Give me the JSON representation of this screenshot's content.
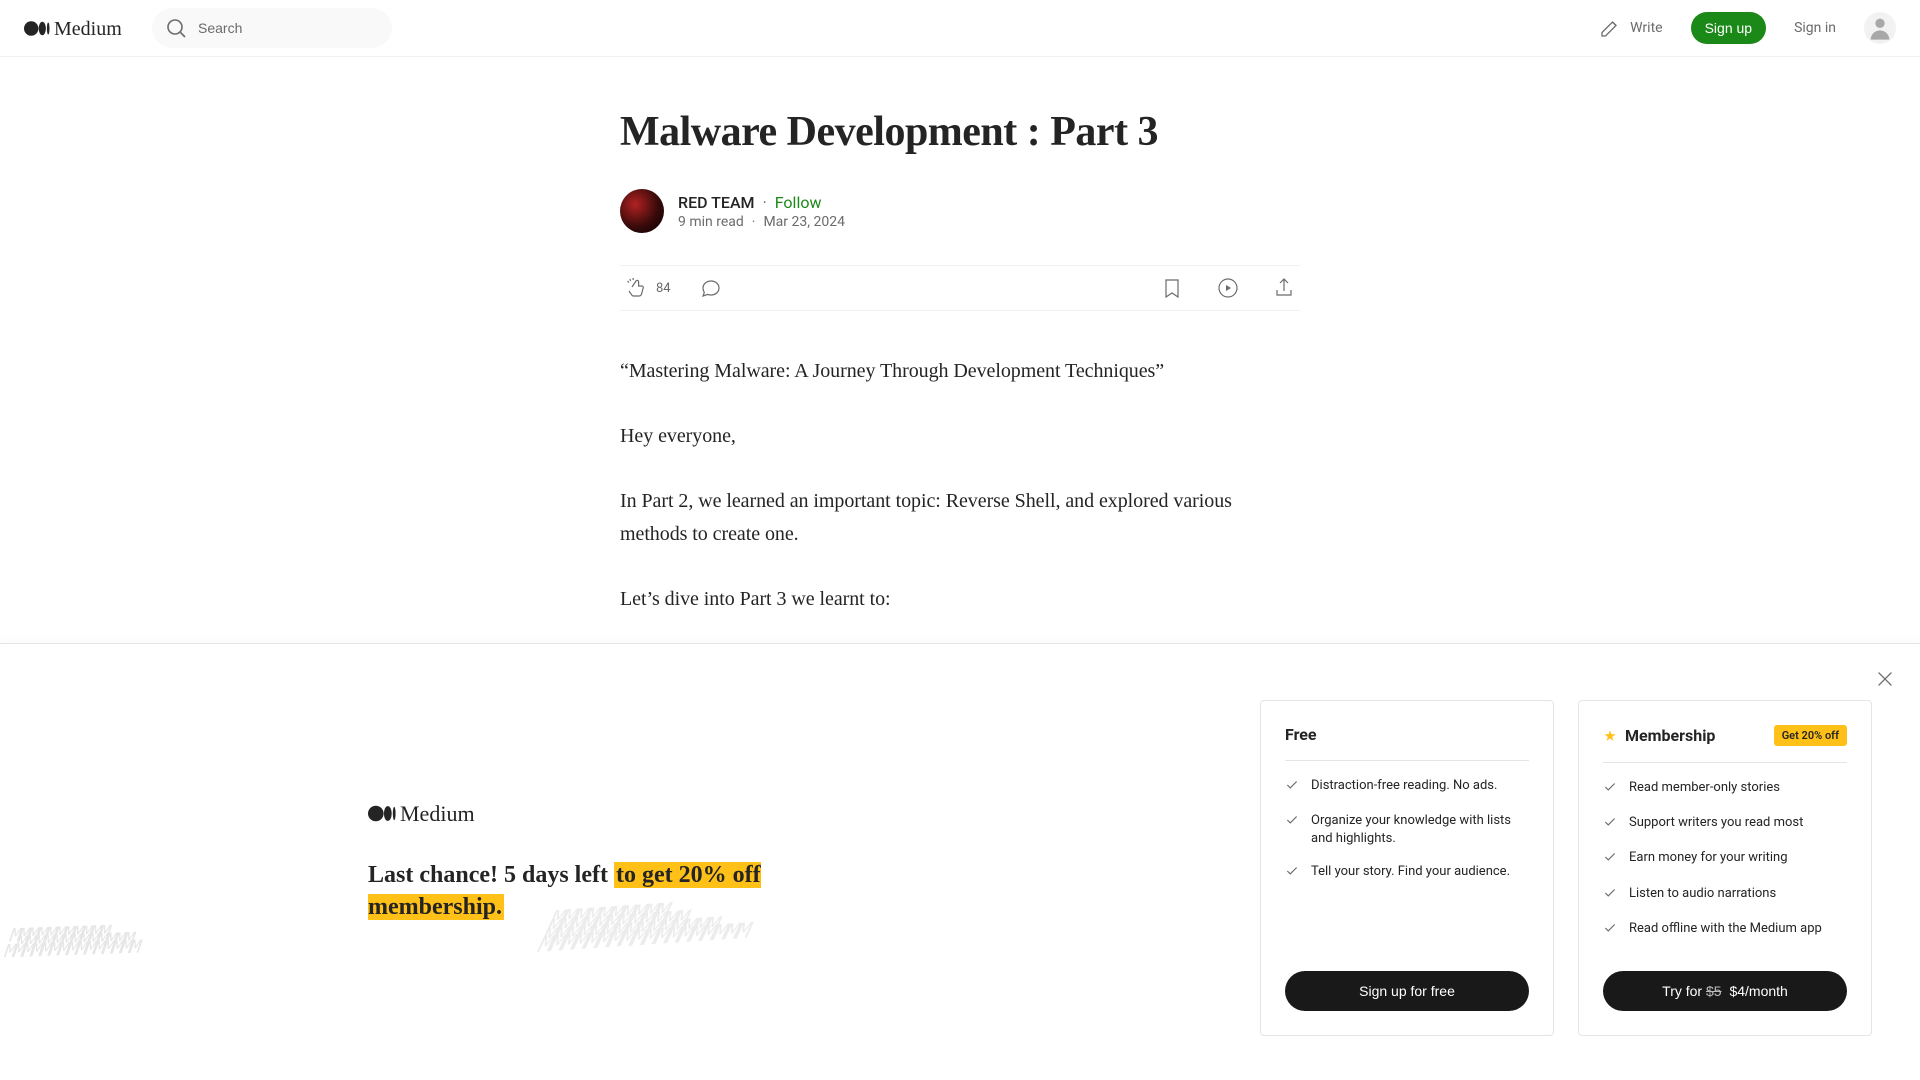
{
  "header": {
    "search_placeholder": "Search",
    "write_label": "Write",
    "signup_label": "Sign up",
    "signin_label": "Sign in"
  },
  "article": {
    "title": "Malware Development : Part 3",
    "author": "RED TEAM",
    "follow_label": "Follow",
    "read_time": "9 min read",
    "date": "Mar 23, 2024",
    "clap_count": "84",
    "paragraphs": [
      "“Mastering Malware: A Journey Through Development Techniques”",
      "Hey everyone,",
      "In Part 2, we learned an important topic: Reverse Shell, and explored various methods to create one.",
      "Let’s dive into Part 3 we learnt to:"
    ]
  },
  "promo": {
    "headline_pre": "Last chance! 5 days left ",
    "headline_hl": "to get 20% off membership.",
    "free": {
      "title": "Free",
      "features": [
        "Distraction-free reading. No ads.",
        "Organize your knowledge with lists and highlights.",
        "Tell your story. Find your audience."
      ],
      "cta": "Sign up for free"
    },
    "member": {
      "title": "Membership",
      "badge": "Get 20% off",
      "features": [
        "Read member-only stories",
        "Support writers you read most",
        "Earn money for your writing",
        "Listen to audio narrations",
        "Read offline with the Medium app"
      ],
      "cta_prefix": "Try for ",
      "cta_strike": "$5",
      "cta_price": " $4/month"
    }
  }
}
